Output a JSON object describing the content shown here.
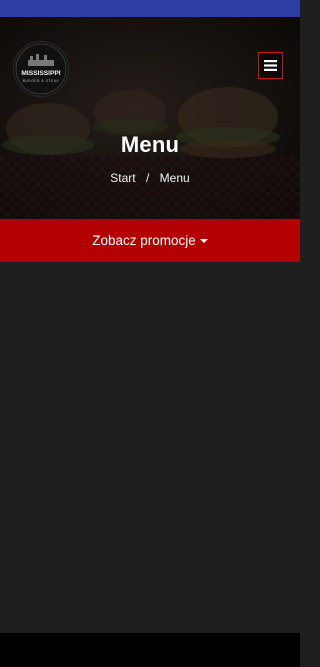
{
  "header": {
    "logo_alt": "Mississippi logo",
    "menu_icon": "hamburger-icon"
  },
  "hero": {
    "title": "Menu",
    "breadcrumb": {
      "home": "Start",
      "separator": "/",
      "current": "Menu"
    }
  },
  "promo": {
    "label": "Zobacz promocje"
  },
  "colors": {
    "status_bar": "#2f3ea3",
    "accent_red": "#b30000",
    "menu_border": "#d11414",
    "background": "#1f1f1f"
  }
}
